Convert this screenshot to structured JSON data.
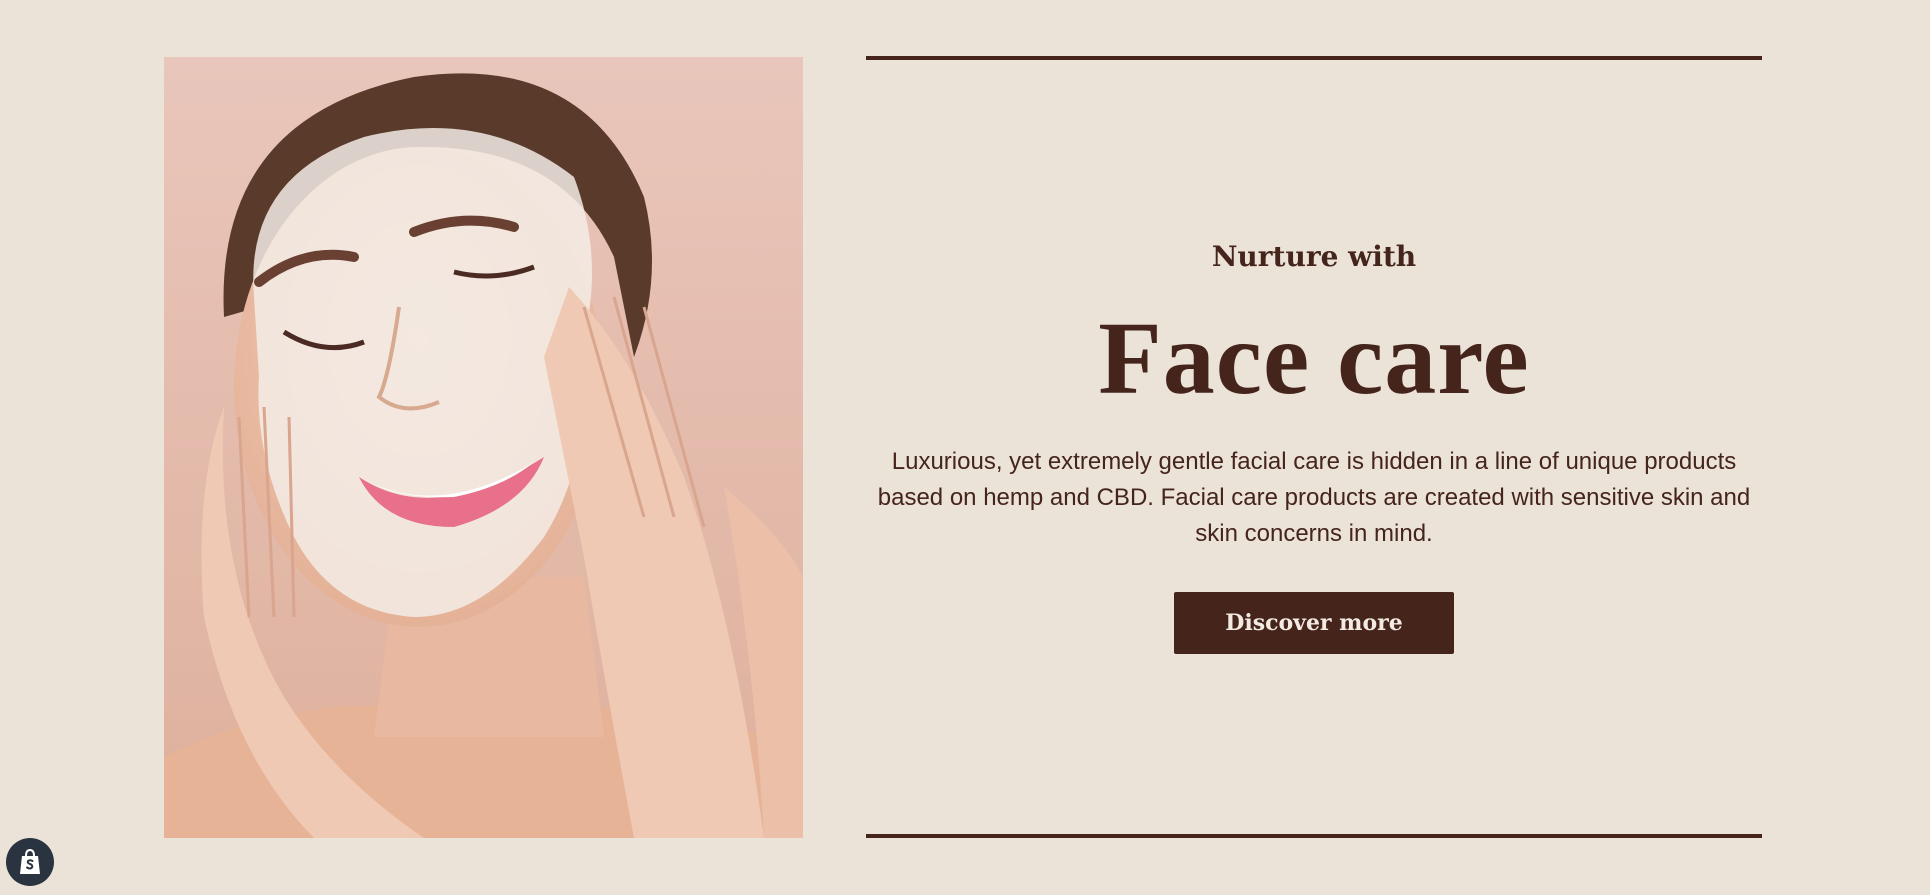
{
  "hero": {
    "image_alt": "Woman smiling while washing her face with foam cleanser",
    "eyebrow": "Nurture with",
    "title": "Face care",
    "description": "Luxurious, yet extremely gentle facial care is hidden in a line of unique products based on hemp and CBD. Facial care products are created with sensitive skin and skin concerns in mind.",
    "cta_label": "Discover more"
  },
  "badge": {
    "icon": "shopify-bag-icon"
  },
  "colors": {
    "background": "#ebe3d8",
    "brand_dark": "#45241c",
    "button_text": "#f3ebe2"
  }
}
